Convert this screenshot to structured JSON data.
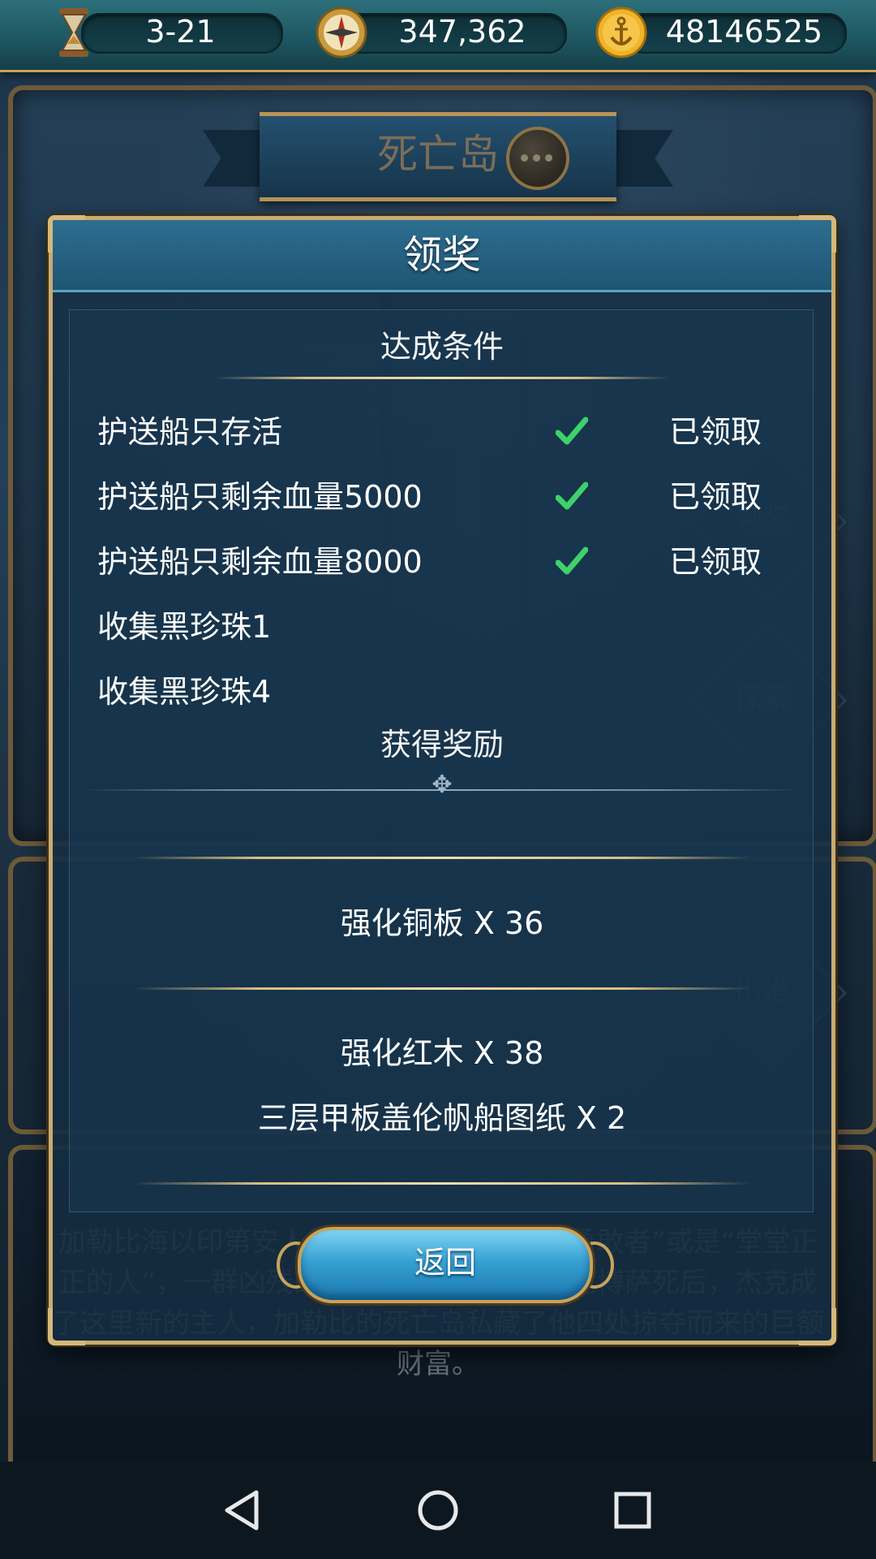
{
  "resources": {
    "stage": "3-21",
    "compass_value": "347,362",
    "gold_value": "48146525",
    "hourglass_icon": "hourglass-icon",
    "compass_icon": "compass-icon",
    "gold_icon": "anchor-coin-icon"
  },
  "island": {
    "name": "死亡岛",
    "side_buttons": [
      "领奖",
      "探索",
      "出港"
    ],
    "lore": "加勒比海以印第安人加勒比命名，意思是“勇敢者”或是“堂堂正正的人”，一群凶残的海盗占据作为据点，巴博萨死后，杰克成了这里新的主人，加勒比的死亡岛私藏了他四处掠夺而来的巨额财富。"
  },
  "dialog": {
    "title": "领奖",
    "conditions_header": "达成条件",
    "conditions": [
      {
        "label": "护送船只存活",
        "completed": true,
        "status": "已领取"
      },
      {
        "label": "护送船只剩余血量5000",
        "completed": true,
        "status": "已领取"
      },
      {
        "label": "护送船只剩余血量8000",
        "completed": true,
        "status": "已领取"
      },
      {
        "label": "收集黑珍珠1",
        "completed": false,
        "status": ""
      },
      {
        "label": "收集黑珍珠4",
        "completed": false,
        "status": ""
      }
    ],
    "rewards_header": "获得奖励",
    "rewards": [
      "强化铜板 X 36",
      "强化红木 X 38",
      "三层甲板盖伦帆船图纸 X 2"
    ],
    "back_label": "返回"
  },
  "colors": {
    "gold_border": "#c9ab72",
    "check_green": "#3fd16a",
    "button_blue": "#36a0d2"
  }
}
